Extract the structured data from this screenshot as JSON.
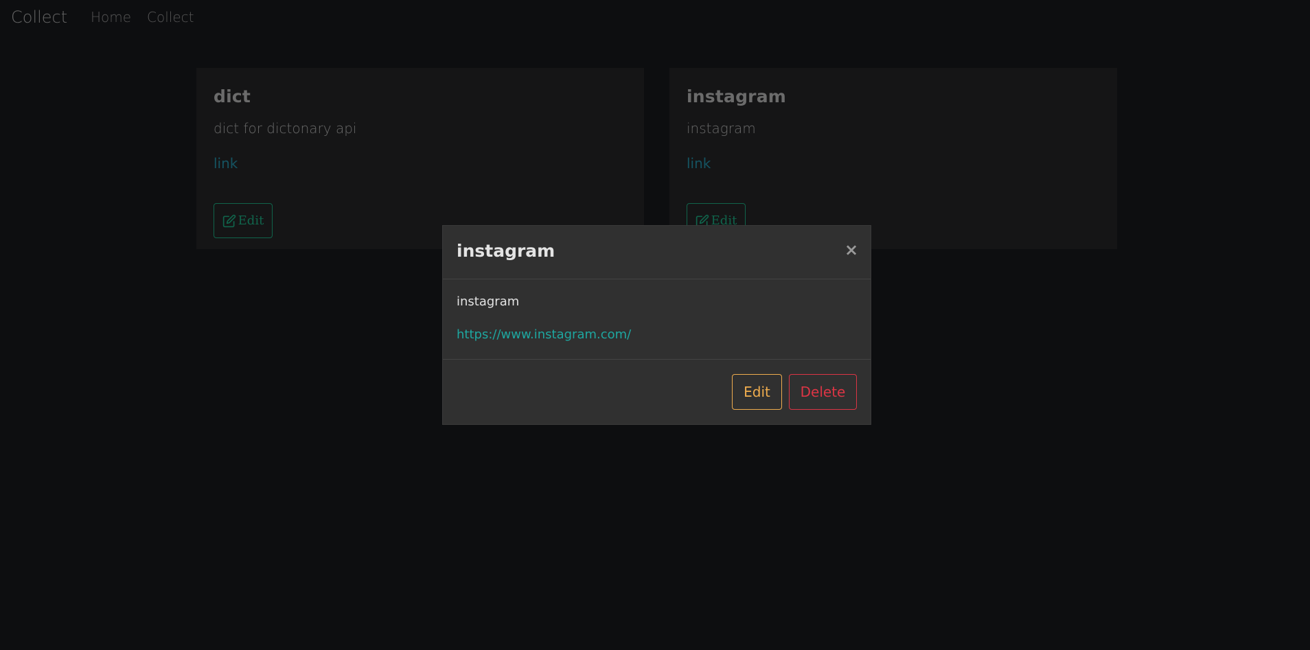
{
  "navbar": {
    "brand": "Collect",
    "links": [
      "Home",
      "Collect"
    ]
  },
  "cards": [
    {
      "title": "dict",
      "description": "dict for dictonary api",
      "link_label": "link",
      "edit_label": "Edit"
    },
    {
      "title": "instagram",
      "description": "instagram",
      "link_label": "link",
      "edit_label": "Edit"
    }
  ],
  "modal": {
    "title": "instagram",
    "close_glyph": "×",
    "description": "instagram",
    "url": "https://www.instagram.com/",
    "edit_label": "Edit",
    "delete_label": "Delete"
  },
  "colors": {
    "background": "#1b1d21",
    "accent_teal": "#20c997",
    "link_blue": "#2aa6c2",
    "warning": "#f0ad4e",
    "danger": "#dc3545"
  }
}
